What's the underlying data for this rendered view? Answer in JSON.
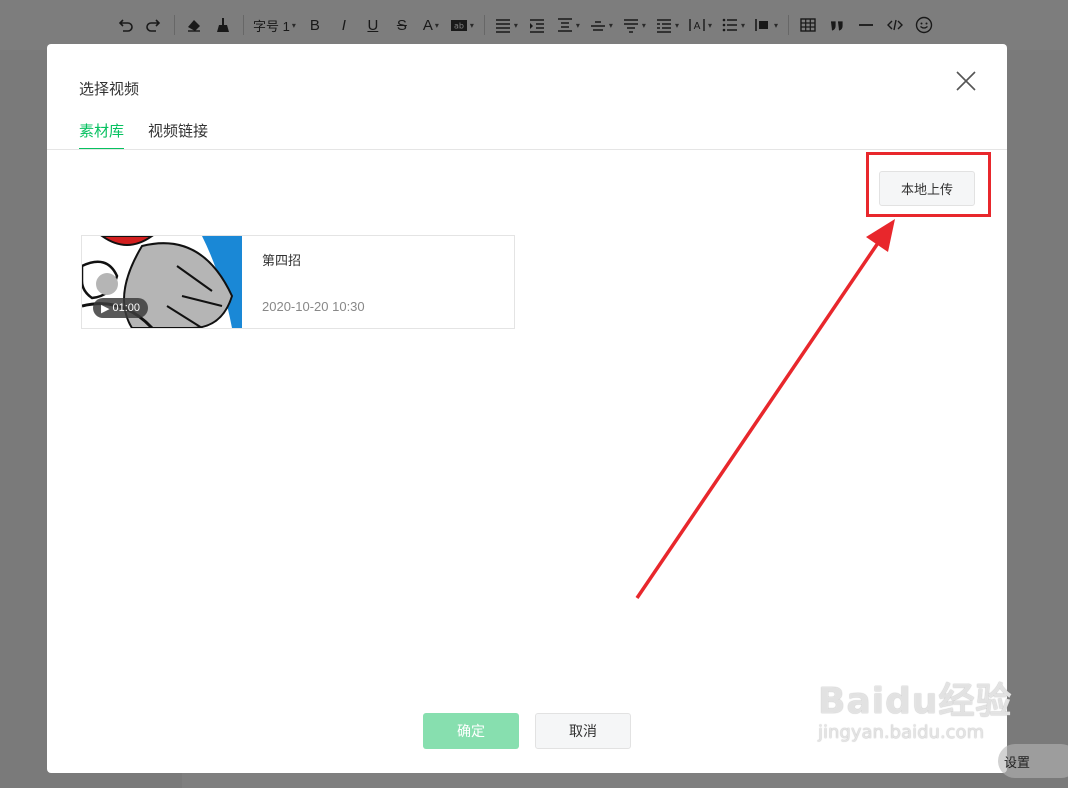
{
  "toolbar": {
    "font_size_label": "字号 1",
    "bold": "B",
    "italic": "I",
    "underline": "U",
    "strike": "S",
    "font_color": "A"
  },
  "dialog": {
    "title": "选择视频",
    "tabs": [
      {
        "label": "素材库",
        "active": true
      },
      {
        "label": "视频链接",
        "active": false
      }
    ],
    "upload_button": "本地上传",
    "videos": [
      {
        "title": "第四招",
        "date": "2020-10-20 10:30",
        "duration": "01:00"
      }
    ],
    "confirm_label": "确定",
    "cancel_label": "取消"
  },
  "watermark": {
    "brand": "Baidu经验",
    "url": "jingyan.baidu.com"
  },
  "settings_label": "设置",
  "colors": {
    "accent": "#07c160",
    "confirm_disabled": "#87dfaf",
    "highlight": "#e8272c"
  }
}
